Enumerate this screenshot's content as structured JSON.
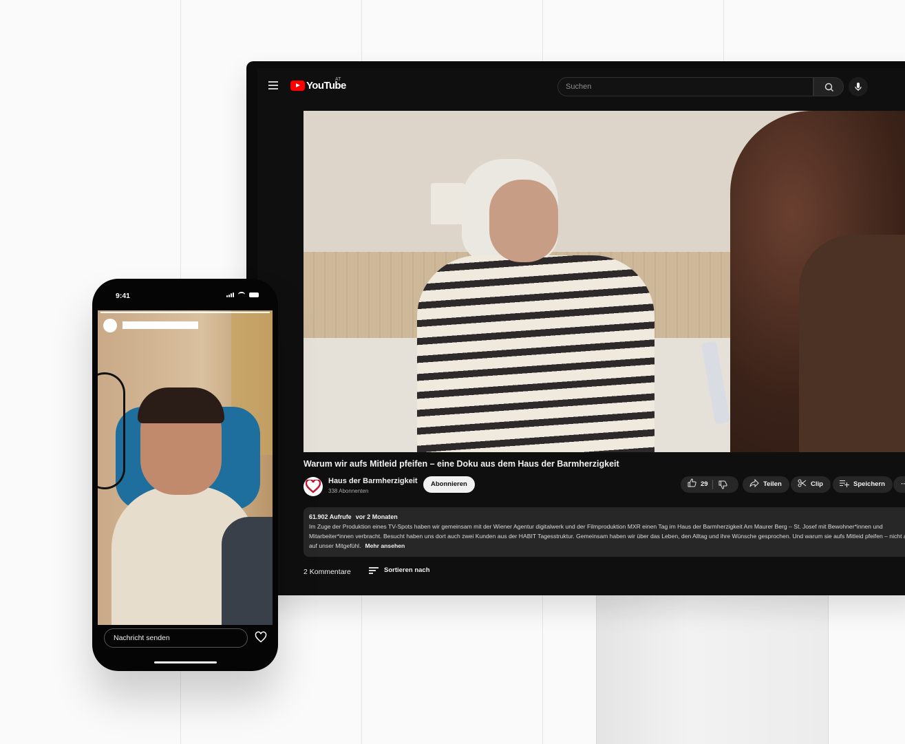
{
  "youtube": {
    "logo_text": "YouTube",
    "logo_country": "AT",
    "search_placeholder": "Suchen",
    "video": {
      "title": "Warum wir aufs Mitleid pfeifen – eine Doku aus dem Haus der Barmherzigkeit"
    },
    "channel": {
      "name": "Haus der Barmherzigkeit",
      "subscribers": "338 Abonnenten",
      "subscribe_label": "Abonnieren"
    },
    "actions": {
      "like_count": "29",
      "share_label": "Teilen",
      "clip_label": "Clip",
      "save_label": "Speichern",
      "more_label": "···"
    },
    "description": {
      "views": "61.902 Aufrufe",
      "date": "vor 2 Monaten",
      "text": "Im Zuge der Produktion eines TV-Spots haben wir gemeinsam mit der Wiener Agentur digitalwerk und der Filmproduktion MXR einen Tag im Haus der Barmherzigkeit Am Maurer Berg – St. Josef mit Bewohner*innen und Mitarbeiter*innen verbracht. Besucht haben uns dort auch zwei Kunden aus der HABIT Tagesstruktur. Gemeinsam haben wir über das Leben, den Alltag und ihre Wünsche gesprochen. Und warum sie aufs Mitleid pfeifen – nicht aber auf unser Mitgefühl.",
      "more_label": "Mehr ansehen"
    },
    "comments": {
      "count_label": "2 Kommentare",
      "sort_label": "Sortieren nach"
    }
  },
  "phone": {
    "time": "9:41",
    "message_placeholder": "Nachricht senden"
  },
  "colors": {
    "youtube_red": "#ff0000",
    "yt_background": "#0f0f0f",
    "channel_heart": "#c8102e"
  }
}
